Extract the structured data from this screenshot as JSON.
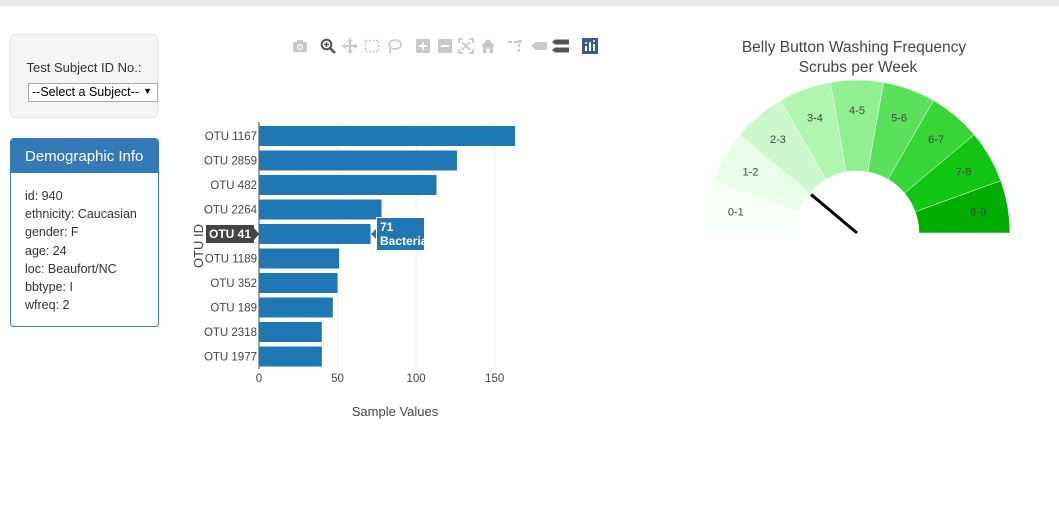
{
  "selector": {
    "label": "Test Subject ID No.:",
    "selected": "--Select a Subject--"
  },
  "demographics": {
    "heading": "Demographic Info",
    "lines": [
      "id: 940",
      "ethnicity: Caucasian",
      "gender: F",
      "age: 24",
      "loc: Beaufort/NC",
      "bbtype: I",
      "wfreq: 2"
    ]
  },
  "modebar_icons": [
    "camera-icon",
    "zoom-icon",
    "pan-icon",
    "box-select-icon",
    "lasso-select-icon",
    "zoom-in-icon",
    "zoom-out-icon",
    "autoscale-icon",
    "reset-axes-icon",
    "spike-lines-icon",
    "hover-closest-icon",
    "hover-compare-icon",
    "plotly-logo-icon"
  ],
  "chart_data": [
    {
      "type": "bar",
      "orientation": "horizontal",
      "categories": [
        "OTU 1167",
        "OTU 2859",
        "OTU 482",
        "OTU 2264",
        "OTU 41",
        "OTU 1189",
        "OTU 352",
        "OTU 189",
        "OTU 2318",
        "OTU 1977"
      ],
      "values": [
        163,
        126,
        113,
        78,
        71,
        51,
        50,
        47,
        40,
        40
      ],
      "xlabel": "Sample Values",
      "ylabel": "OTU ID",
      "xticks": [
        0,
        50,
        100,
        150
      ],
      "xlim": [
        0,
        165
      ],
      "grid": true,
      "color": "#1f77b4",
      "hover": {
        "category": "OTU 41",
        "value_text": "71",
        "label_text": "Bacteria"
      }
    },
    {
      "type": "gauge",
      "title": "Belly Button Washing Frequency",
      "subtitle": "Scrubs per Week",
      "range": [
        0,
        9
      ],
      "segments": [
        "0-1",
        "1-2",
        "2-3",
        "3-4",
        "4-5",
        "5-6",
        "6-7",
        "7-8",
        "8-9"
      ],
      "segment_colors": [
        "#f8fff8",
        "#e8ffe8",
        "#ccf8cc",
        "#b0f5b0",
        "#90f090",
        "#5ae05a",
        "#36d636",
        "#14c614",
        "#00ad00"
      ],
      "value": 2
    }
  ]
}
